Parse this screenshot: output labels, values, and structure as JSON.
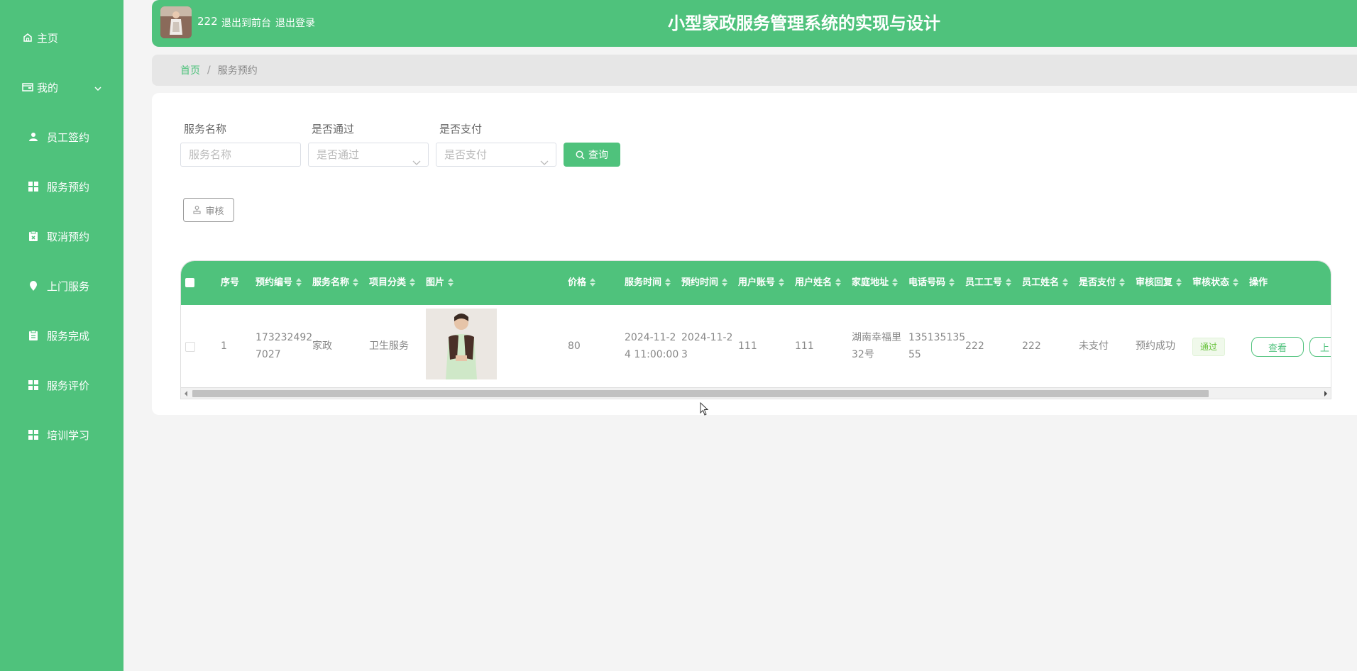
{
  "sidebar": {
    "home": "主页",
    "mine": "我的",
    "items": [
      {
        "label": "员工签约",
        "icon": "person-icon"
      },
      {
        "label": "服务预约",
        "icon": "grid-icon"
      },
      {
        "label": "取消预约",
        "icon": "clipboard-x-icon"
      },
      {
        "label": "上门服务",
        "icon": "location-pin-icon"
      },
      {
        "label": "服务完成",
        "icon": "clipboard-icon"
      },
      {
        "label": "服务评价",
        "icon": "grid-icon"
      },
      {
        "label": "培训学习",
        "icon": "grid-icon"
      }
    ]
  },
  "header": {
    "user": "222",
    "back_front": "退出到前台",
    "logout": "退出登录",
    "title": "小型家政服务管理系统的实现与设计"
  },
  "breadcrumb": {
    "home": "首页",
    "sep": "/",
    "current": "服务预约"
  },
  "filters": {
    "service_name": {
      "label": "服务名称",
      "placeholder": "服务名称"
    },
    "passed": {
      "label": "是否通过",
      "placeholder": "是否通过"
    },
    "paid": {
      "label": "是否支付",
      "placeholder": "是否支付"
    },
    "query": "查询"
  },
  "actions": {
    "audit": "审核"
  },
  "table": {
    "columns": [
      "序号",
      "预约编号",
      "服务名称",
      "项目分类",
      "图片",
      "价格",
      "服务时间",
      "预约时间",
      "用户账号",
      "用户姓名",
      "家庭地址",
      "电话号码",
      "员工工号",
      "员工姓名",
      "是否支付",
      "审核回复",
      "审核状态",
      "操作"
    ],
    "rows": [
      {
        "index": "1",
        "booking_no_1": "173232492",
        "booking_no_2": "7027",
        "service_name": "家政",
        "category": "卫生服务",
        "price": "80",
        "service_time_1": "2024-11-2",
        "service_time_2": "4 11:00:00",
        "booking_time_1": "2024-11-2",
        "booking_time_2": "3",
        "user_account": "111",
        "user_name": "111",
        "address_1": "湖南幸福里",
        "address_2": "32号",
        "phone_1": "135135135",
        "phone_2": "55",
        "staff_no": "222",
        "staff_name": "222",
        "paid": "未支付",
        "audit_reply": "预约成功",
        "audit_status": "通过",
        "op_view": "查看",
        "op_next": "上"
      }
    ]
  },
  "colors": {
    "primary": "#4fc27c",
    "breadcrumb_bg": "#e6e6e6",
    "page_bg": "#f4f4f4"
  }
}
